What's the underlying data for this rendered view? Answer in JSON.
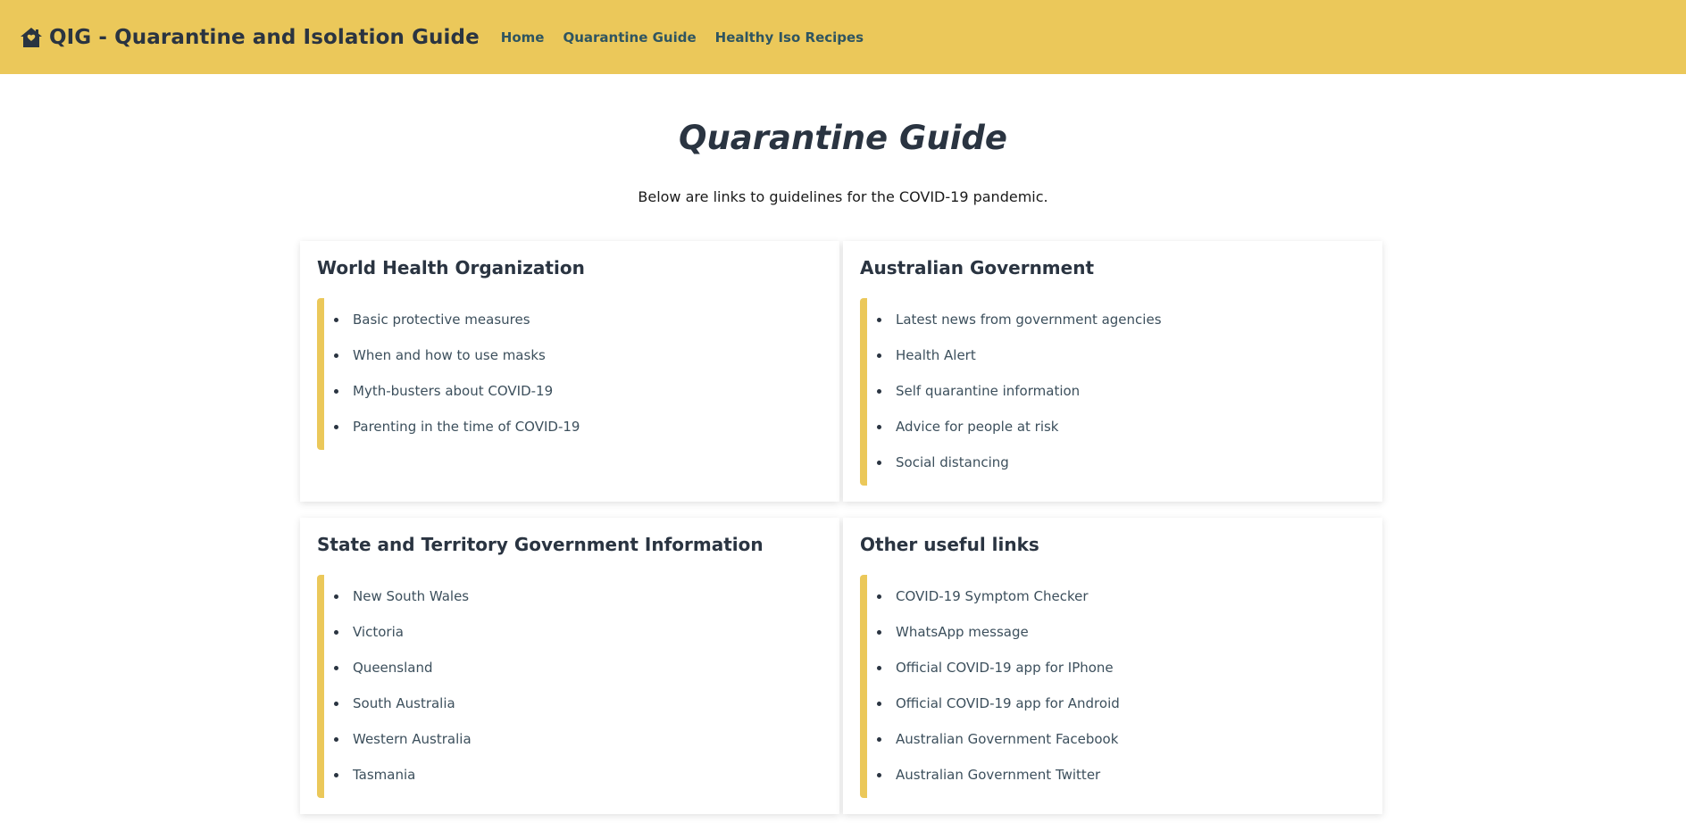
{
  "navbar": {
    "brand": "QIG - Quarantine and Isolation Guide",
    "brand_icon": "house-icon",
    "links": [
      "Home",
      "Quarantine Guide",
      "Healthy Iso Recipes"
    ]
  },
  "page": {
    "title": "Quarantine Guide",
    "intro": "Below are links to guidelines for the COVID-19 pandemic."
  },
  "cards": [
    {
      "title": "World Health Organization",
      "links": [
        "Basic protective measures",
        "When and how to use masks",
        "Myth-busters about COVID-19",
        "Parenting in the time of COVID-19"
      ]
    },
    {
      "title": "Australian Government",
      "links": [
        "Latest news from government agencies",
        "Health Alert",
        "Self quarantine information",
        "Advice for people at risk",
        "Social distancing"
      ]
    },
    {
      "title": "State and Territory Government Information",
      "links": [
        "New South Wales",
        "Victoria",
        "Queensland",
        "South Australia",
        "Western Australia",
        "Tasmania"
      ]
    },
    {
      "title": "Other useful links",
      "links": [
        "COVID-19 Symptom Checker",
        "WhatsApp message",
        "Official COVID-19 app for IPhone",
        "Official COVID-19 app for Android",
        "Australian Government Facebook",
        "Australian Government Twitter"
      ]
    }
  ],
  "colors": {
    "accent": "#ebc85a",
    "heading": "#2a3441",
    "link": "#3c4f5c"
  }
}
